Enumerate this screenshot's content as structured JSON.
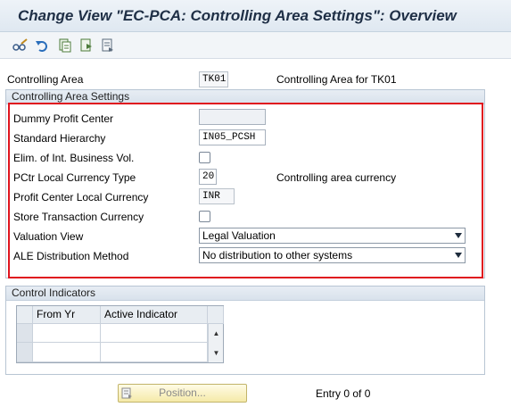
{
  "title": "Change View \"EC-PCA: Controlling Area Settings\": Overview",
  "toolbar": {
    "icons": [
      "glasses-pencil-icon",
      "undo-icon",
      "copy-entry-icon",
      "export-icon",
      "details-icon"
    ]
  },
  "controlling_area": {
    "label": "Controlling Area",
    "value": "TK01",
    "description": "Controlling Area for TK01"
  },
  "settings_group": {
    "title": "Controlling Area Settings",
    "dummy_profit_center": {
      "label": "Dummy Profit Center",
      "value": ""
    },
    "standard_hierarchy": {
      "label": "Standard Hierarchy",
      "value": "IN05_PCSH"
    },
    "elim_int_business": {
      "label": "Elim. of Int. Business Vol.",
      "checked": false
    },
    "pctr_local_currency_type": {
      "label": "PCtr Local Currency Type",
      "value": "20",
      "description": "Controlling area currency"
    },
    "profit_center_local_currency": {
      "label": "Profit Center Local Currency",
      "value": "INR"
    },
    "store_transaction_currency": {
      "label": "Store Transaction Currency",
      "checked": false
    },
    "valuation_view": {
      "label": "Valuation View",
      "value": "Legal Valuation"
    },
    "ale_distribution": {
      "label": "ALE Distribution Method",
      "value": "No distribution to other systems"
    }
  },
  "control_indicators": {
    "title": "Control Indicators",
    "columns": [
      "From Yr",
      "Active Indicator"
    ],
    "rows": [
      [
        "",
        ""
      ],
      [
        "",
        ""
      ]
    ]
  },
  "footer": {
    "position_label": "Position...",
    "entry_text": "Entry 0 of 0"
  },
  "colors": {
    "highlight": "#e0141e",
    "title": "#1f2f46"
  }
}
